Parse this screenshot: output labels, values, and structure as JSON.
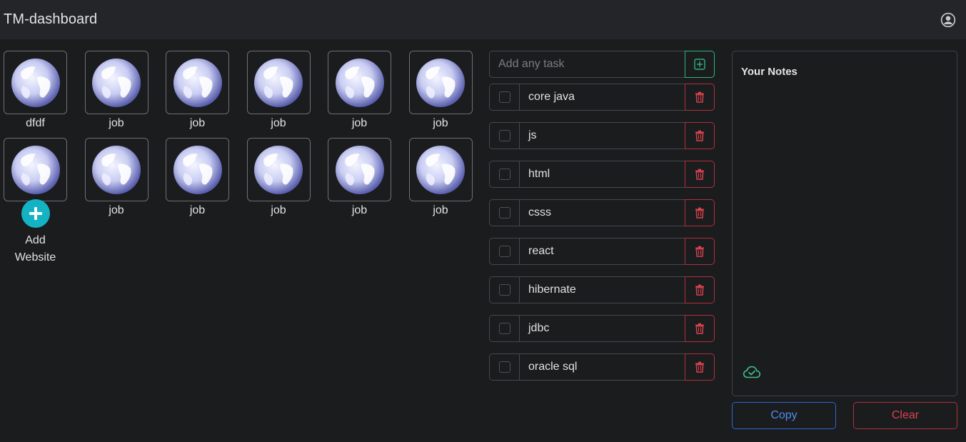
{
  "app": {
    "title": "TM-dashboard"
  },
  "icons": {
    "profile": "person-circle-icon",
    "site": "globe-icon",
    "add_site": "plus-icon",
    "add_task": "plus-square-icon",
    "delete_task": "trash-icon",
    "cloud": "cloud-check-icon"
  },
  "colors": {
    "background": "#1b1c1e",
    "navbar": "#232528",
    "accent_teal": "#13b3c4",
    "success": "#2fb47a",
    "danger": "#b0303b",
    "primary": "#2a67d6"
  },
  "websites": {
    "items": [
      {
        "label": "dfdf"
      },
      {
        "label": "job"
      },
      {
        "label": "job"
      },
      {
        "label": "job"
      },
      {
        "label": "job"
      },
      {
        "label": "job"
      },
      {
        "label": "job"
      },
      {
        "label": "job"
      },
      {
        "label": "job"
      },
      {
        "label": "job"
      },
      {
        "label": "job"
      },
      {
        "label": "job"
      }
    ],
    "add_label_line1": "Add",
    "add_label_line2": "Website"
  },
  "tasks": {
    "input_placeholder": "Add any task",
    "input_value": "",
    "items": [
      {
        "text": "core java",
        "done": false
      },
      {
        "text": "js",
        "done": false
      },
      {
        "text": "html",
        "done": false
      },
      {
        "text": "csss",
        "done": false
      },
      {
        "text": "react",
        "done": false
      },
      {
        "text": "hibernate",
        "done": false
      },
      {
        "text": "jdbc",
        "done": false
      },
      {
        "text": "oracle sql",
        "done": false
      }
    ]
  },
  "notes": {
    "title": "Your Notes",
    "content": "",
    "copy_label": "Copy",
    "clear_label": "Clear"
  }
}
